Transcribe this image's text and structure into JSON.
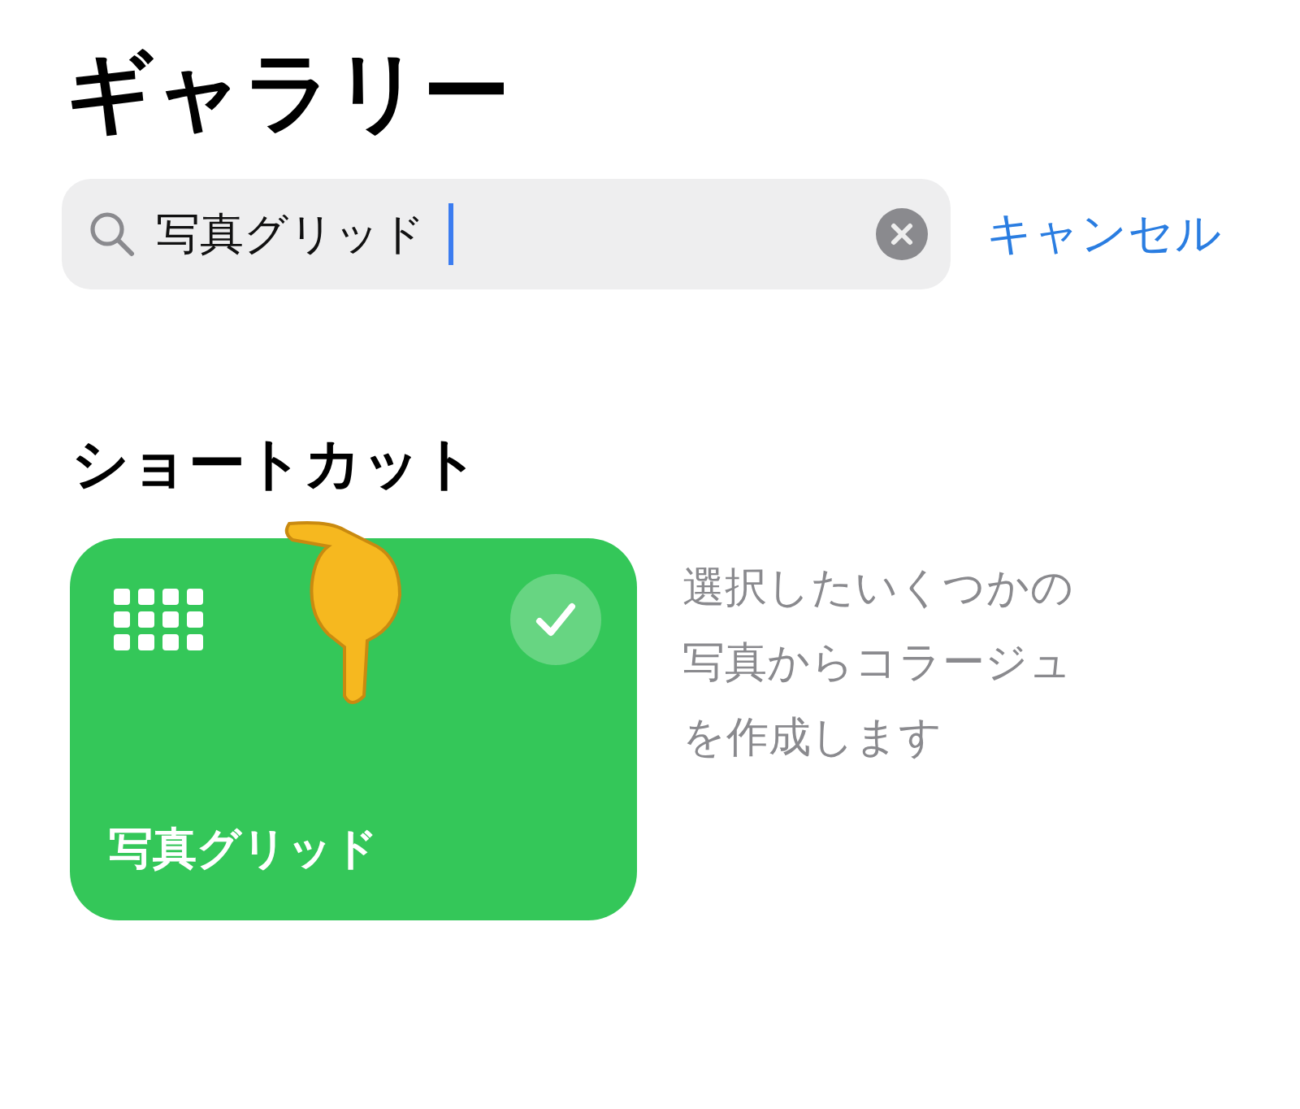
{
  "title": "ギャラリー",
  "search": {
    "value": "写真グリッド",
    "focused": true,
    "cancel": "キャンセル"
  },
  "section": {
    "heading": "ショートカット",
    "shortcuts": [
      {
        "name": "写真グリッド",
        "selected": true,
        "color": "#34c759",
        "description": "選択したいくつかの写真からコラージュを作成します"
      }
    ]
  }
}
